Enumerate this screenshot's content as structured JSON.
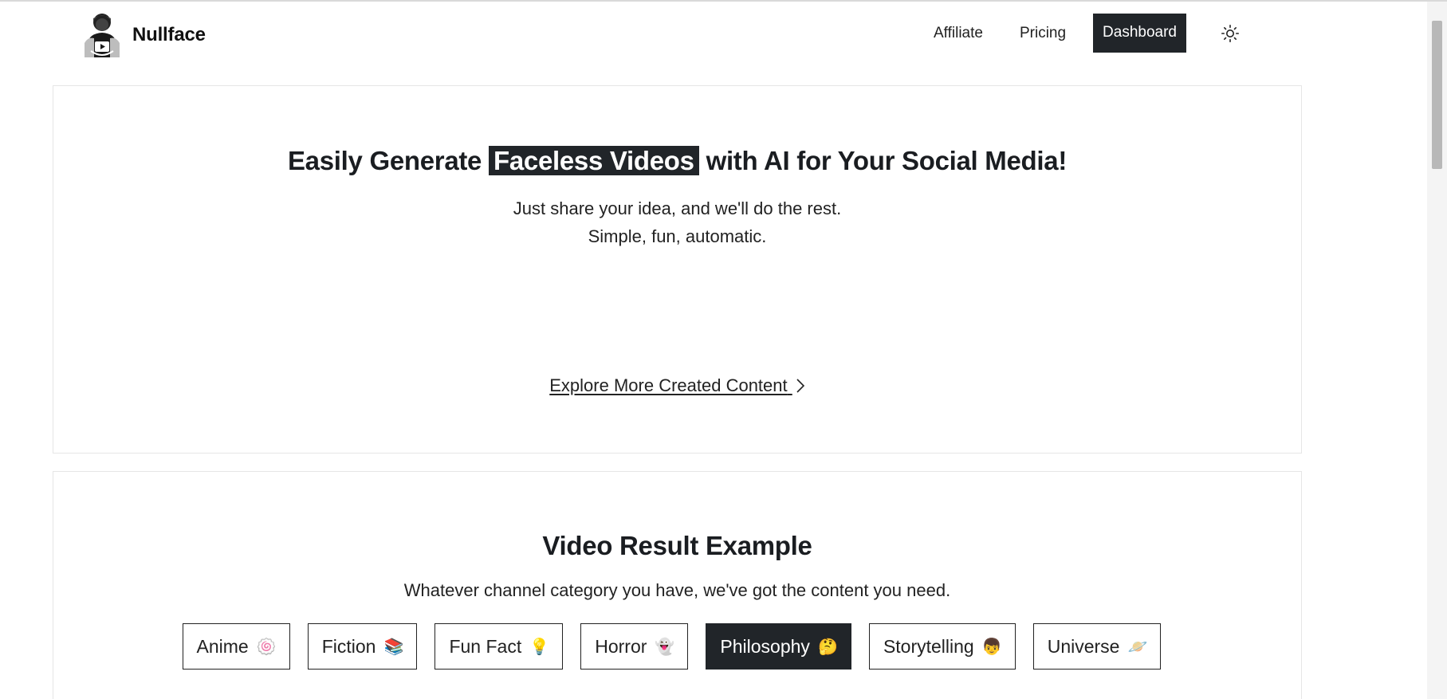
{
  "header": {
    "brand": "Nullface",
    "nav": [
      {
        "label": "Affiliate"
      },
      {
        "label": "Pricing"
      },
      {
        "label": "Dashboard"
      }
    ],
    "theme_icon": "sun-icon"
  },
  "hero": {
    "title_before": "Easily Generate ",
    "title_highlight": "Faceless Videos",
    "title_after": " with AI for Your Social Media!",
    "subtitle_line1": "Just share your idea, and we'll do the rest.",
    "subtitle_line2": "Simple, fun, automatic.",
    "explore_link": "Explore More Created Content"
  },
  "examples": {
    "title": "Video Result Example",
    "subtitle": "Whatever channel category you have, we've got the content you need.",
    "categories": [
      {
        "label": "Anime",
        "emoji": "🍥"
      },
      {
        "label": "Fiction",
        "emoji": "📚"
      },
      {
        "label": "Fun Fact",
        "emoji": "💡"
      },
      {
        "label": "Horror",
        "emoji": "👻"
      },
      {
        "label": "Philosophy",
        "emoji": "🤔"
      },
      {
        "label": "Storytelling",
        "emoji": "👦"
      },
      {
        "label": "Universe",
        "emoji": "🪐"
      }
    ],
    "active_category": "Philosophy"
  },
  "colors": {
    "accent_dark": "#212529",
    "border": "#e6e6e6"
  }
}
